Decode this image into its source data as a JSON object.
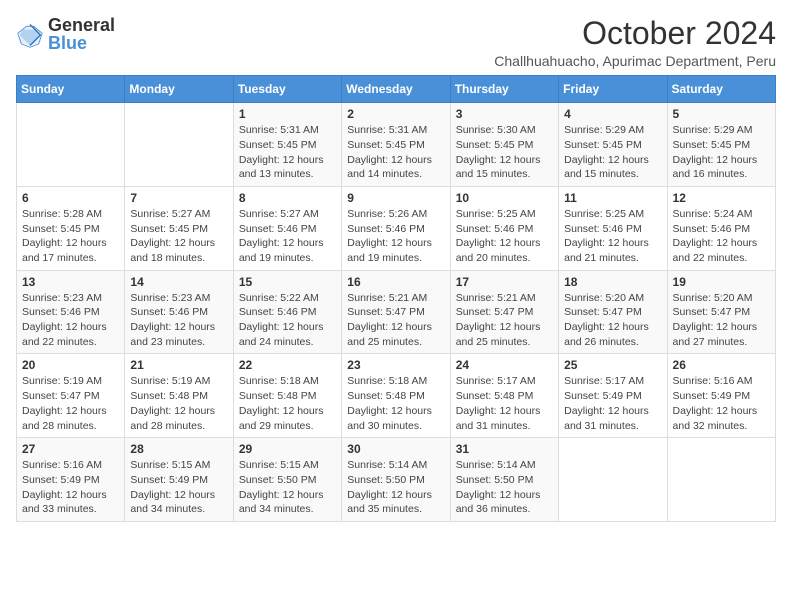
{
  "logo": {
    "general": "General",
    "blue": "Blue"
  },
  "header": {
    "title": "October 2024",
    "subtitle": "Challhuahuacho, Apurimac Department, Peru"
  },
  "weekdays": [
    "Sunday",
    "Monday",
    "Tuesday",
    "Wednesday",
    "Thursday",
    "Friday",
    "Saturday"
  ],
  "weeks": [
    [
      {
        "day": "",
        "info": ""
      },
      {
        "day": "",
        "info": ""
      },
      {
        "day": "1",
        "info": "Sunrise: 5:31 AM\nSunset: 5:45 PM\nDaylight: 12 hours and 13 minutes."
      },
      {
        "day": "2",
        "info": "Sunrise: 5:31 AM\nSunset: 5:45 PM\nDaylight: 12 hours and 14 minutes."
      },
      {
        "day": "3",
        "info": "Sunrise: 5:30 AM\nSunset: 5:45 PM\nDaylight: 12 hours and 15 minutes."
      },
      {
        "day": "4",
        "info": "Sunrise: 5:29 AM\nSunset: 5:45 PM\nDaylight: 12 hours and 15 minutes."
      },
      {
        "day": "5",
        "info": "Sunrise: 5:29 AM\nSunset: 5:45 PM\nDaylight: 12 hours and 16 minutes."
      }
    ],
    [
      {
        "day": "6",
        "info": "Sunrise: 5:28 AM\nSunset: 5:45 PM\nDaylight: 12 hours and 17 minutes."
      },
      {
        "day": "7",
        "info": "Sunrise: 5:27 AM\nSunset: 5:45 PM\nDaylight: 12 hours and 18 minutes."
      },
      {
        "day": "8",
        "info": "Sunrise: 5:27 AM\nSunset: 5:46 PM\nDaylight: 12 hours and 19 minutes."
      },
      {
        "day": "9",
        "info": "Sunrise: 5:26 AM\nSunset: 5:46 PM\nDaylight: 12 hours and 19 minutes."
      },
      {
        "day": "10",
        "info": "Sunrise: 5:25 AM\nSunset: 5:46 PM\nDaylight: 12 hours and 20 minutes."
      },
      {
        "day": "11",
        "info": "Sunrise: 5:25 AM\nSunset: 5:46 PM\nDaylight: 12 hours and 21 minutes."
      },
      {
        "day": "12",
        "info": "Sunrise: 5:24 AM\nSunset: 5:46 PM\nDaylight: 12 hours and 22 minutes."
      }
    ],
    [
      {
        "day": "13",
        "info": "Sunrise: 5:23 AM\nSunset: 5:46 PM\nDaylight: 12 hours and 22 minutes."
      },
      {
        "day": "14",
        "info": "Sunrise: 5:23 AM\nSunset: 5:46 PM\nDaylight: 12 hours and 23 minutes."
      },
      {
        "day": "15",
        "info": "Sunrise: 5:22 AM\nSunset: 5:46 PM\nDaylight: 12 hours and 24 minutes."
      },
      {
        "day": "16",
        "info": "Sunrise: 5:21 AM\nSunset: 5:47 PM\nDaylight: 12 hours and 25 minutes."
      },
      {
        "day": "17",
        "info": "Sunrise: 5:21 AM\nSunset: 5:47 PM\nDaylight: 12 hours and 25 minutes."
      },
      {
        "day": "18",
        "info": "Sunrise: 5:20 AM\nSunset: 5:47 PM\nDaylight: 12 hours and 26 minutes."
      },
      {
        "day": "19",
        "info": "Sunrise: 5:20 AM\nSunset: 5:47 PM\nDaylight: 12 hours and 27 minutes."
      }
    ],
    [
      {
        "day": "20",
        "info": "Sunrise: 5:19 AM\nSunset: 5:47 PM\nDaylight: 12 hours and 28 minutes."
      },
      {
        "day": "21",
        "info": "Sunrise: 5:19 AM\nSunset: 5:48 PM\nDaylight: 12 hours and 28 minutes."
      },
      {
        "day": "22",
        "info": "Sunrise: 5:18 AM\nSunset: 5:48 PM\nDaylight: 12 hours and 29 minutes."
      },
      {
        "day": "23",
        "info": "Sunrise: 5:18 AM\nSunset: 5:48 PM\nDaylight: 12 hours and 30 minutes."
      },
      {
        "day": "24",
        "info": "Sunrise: 5:17 AM\nSunset: 5:48 PM\nDaylight: 12 hours and 31 minutes."
      },
      {
        "day": "25",
        "info": "Sunrise: 5:17 AM\nSunset: 5:49 PM\nDaylight: 12 hours and 31 minutes."
      },
      {
        "day": "26",
        "info": "Sunrise: 5:16 AM\nSunset: 5:49 PM\nDaylight: 12 hours and 32 minutes."
      }
    ],
    [
      {
        "day": "27",
        "info": "Sunrise: 5:16 AM\nSunset: 5:49 PM\nDaylight: 12 hours and 33 minutes."
      },
      {
        "day": "28",
        "info": "Sunrise: 5:15 AM\nSunset: 5:49 PM\nDaylight: 12 hours and 34 minutes."
      },
      {
        "day": "29",
        "info": "Sunrise: 5:15 AM\nSunset: 5:50 PM\nDaylight: 12 hours and 34 minutes."
      },
      {
        "day": "30",
        "info": "Sunrise: 5:14 AM\nSunset: 5:50 PM\nDaylight: 12 hours and 35 minutes."
      },
      {
        "day": "31",
        "info": "Sunrise: 5:14 AM\nSunset: 5:50 PM\nDaylight: 12 hours and 36 minutes."
      },
      {
        "day": "",
        "info": ""
      },
      {
        "day": "",
        "info": ""
      }
    ]
  ]
}
